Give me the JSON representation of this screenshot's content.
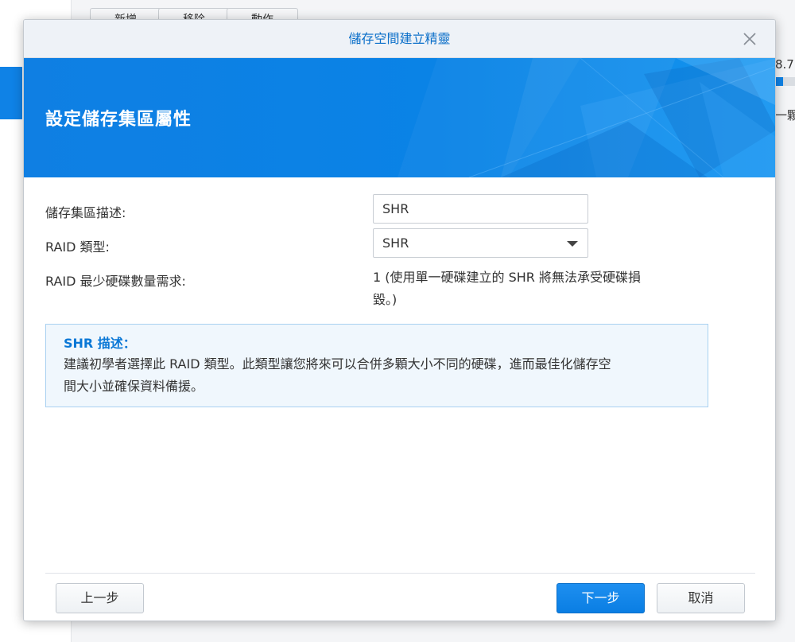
{
  "background": {
    "toolbar_buttons": [
      "新增",
      "移除",
      "動作"
    ],
    "right_fragment_1": "8.7",
    "right_fragment_2": "一顆硬",
    "usage_fraction": 0.4
  },
  "dialog": {
    "title": "儲存空間建立精靈",
    "banner_heading": "設定儲存集區屬性",
    "fields": {
      "description": {
        "label": "儲存集區描述:",
        "value": "SHR"
      },
      "raid_type": {
        "label": "RAID 類型:",
        "selected": "SHR"
      },
      "min_disks": {
        "label": "RAID 最少硬碟數量需求:",
        "value_line1": "1 (使用單一硬碟建立的 SHR 將無法承受硬碟損",
        "value_line2": "毀。)"
      }
    },
    "info": {
      "title": "SHR 描述：",
      "line1": "建議初學者選擇此 RAID 類型。此類型讓您將來可以合併多顆大小不同的硬碟，進而最佳化儲存空",
      "line2": "間大小並確保資料備援。"
    },
    "buttons": {
      "back": "上一步",
      "next": "下一步",
      "cancel": "取消"
    }
  },
  "colors": {
    "accent": "#0f82e6",
    "title_text": "#0b6fc9",
    "info_title": "#0b78d6",
    "info_bg": "#f0f7fd",
    "info_border": "#a9d1f1"
  },
  "icons": {
    "close": "close-icon",
    "dropdown": "chevron-down-icon"
  }
}
